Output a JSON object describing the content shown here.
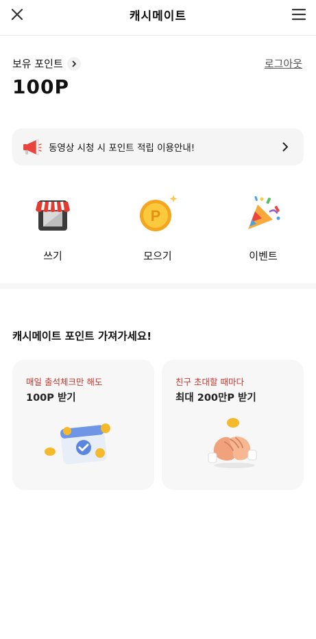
{
  "header": {
    "title": "캐시메이트",
    "close_icon": "close-icon",
    "menu_icon": "hamburger-menu-icon"
  },
  "points": {
    "label": "보유 포인트",
    "value": "100P",
    "logout_label": "로그아웃"
  },
  "notice": {
    "text": "동영상 시청 시 포인트 적립 이용안내!",
    "icon": "megaphone-icon"
  },
  "quick_menu": [
    {
      "label": "쓰기",
      "icon": "store-icon"
    },
    {
      "label": "모으기",
      "icon": "coin-icon"
    },
    {
      "label": "이벤트",
      "icon": "party-popper-icon"
    }
  ],
  "section": {
    "title": "캐시메이트 포인트 가져가세요!"
  },
  "cards": [
    {
      "small": "매일 출석체크만 해도",
      "big": "100P 받기",
      "icon": "calendar-check-icon"
    },
    {
      "small": "친구 초대할 때마다",
      "big": "최대 200만P 받기",
      "icon": "handshake-icon"
    }
  ],
  "colors": {
    "accent_red": "#c8342a",
    "card_bg": "#f7f7f7",
    "notice_bg": "#f5f5f5"
  }
}
